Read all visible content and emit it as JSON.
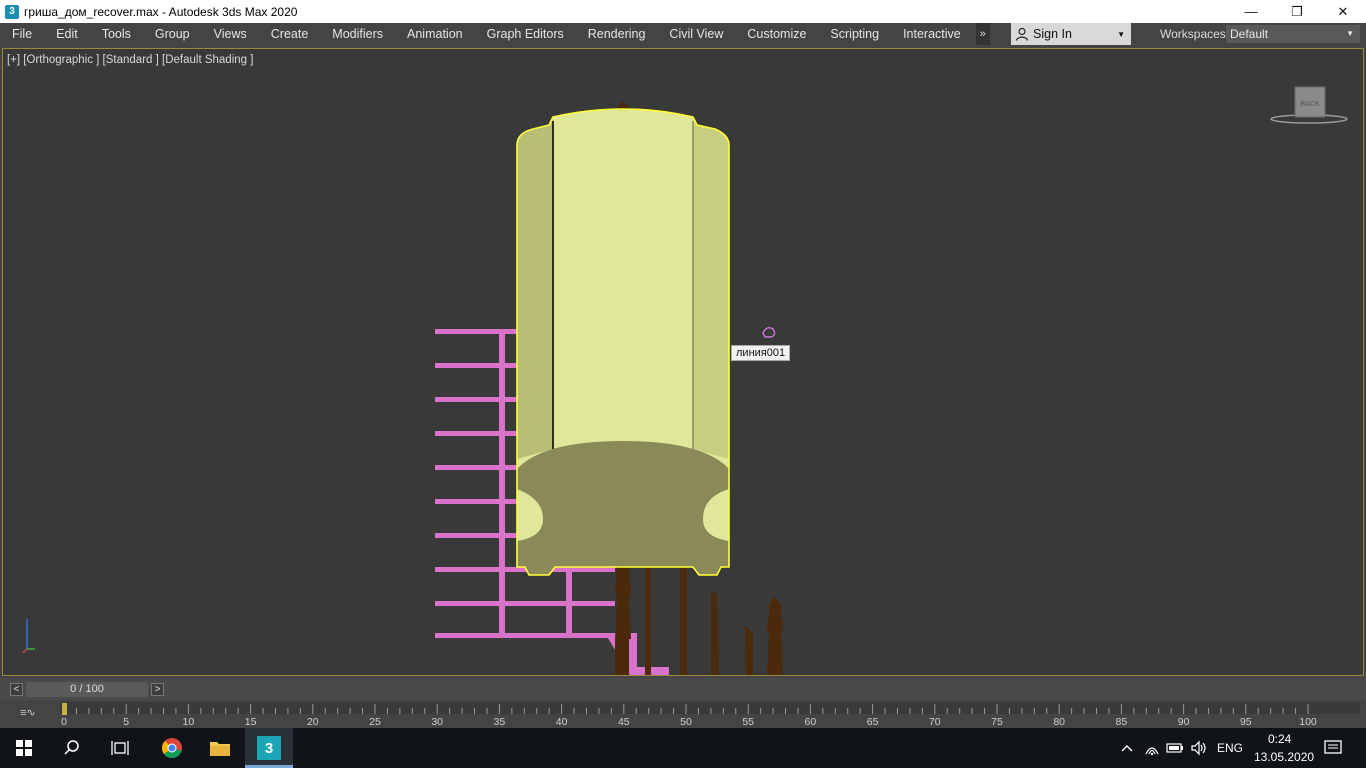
{
  "window": {
    "icon_text": "3",
    "title": "гриша_дом_recover.max - Autodesk 3ds Max 2020",
    "minimize": "—",
    "restore": "❐",
    "close": "✕"
  },
  "menu": {
    "items": [
      "File",
      "Edit",
      "Tools",
      "Group",
      "Views",
      "Create",
      "Modifiers",
      "Animation",
      "Graph Editors",
      "Rendering",
      "Civil View",
      "Customize",
      "Scripting",
      "Interactive"
    ],
    "more": "»",
    "sign_in": "Sign In",
    "workspaces_label": "Workspaces:",
    "workspace_value": "Default"
  },
  "viewport": {
    "label": "[+] [Orthographic ] [Standard ] [Default Shading ]",
    "viewcube_face": "BACK",
    "tooltip": "линия001",
    "selection_color": "#ffff33",
    "tower_color": "#dfe89a",
    "shadow_color": "#8a8a58",
    "railing_color": "#d873c9",
    "baluster_color": "#4b2a0c"
  },
  "timeline": {
    "prev": "<",
    "frame": "0 / 100",
    "next": ">",
    "ticks": [
      "0",
      "5",
      "10",
      "15",
      "20",
      "25",
      "30",
      "35",
      "40",
      "45",
      "50",
      "55",
      "60",
      "65",
      "70",
      "75",
      "80",
      "85",
      "90",
      "95",
      "100"
    ]
  },
  "taskbar": {
    "lang": "ENG",
    "time": "0:24",
    "date": "13.05.2020",
    "app_label": "3"
  }
}
